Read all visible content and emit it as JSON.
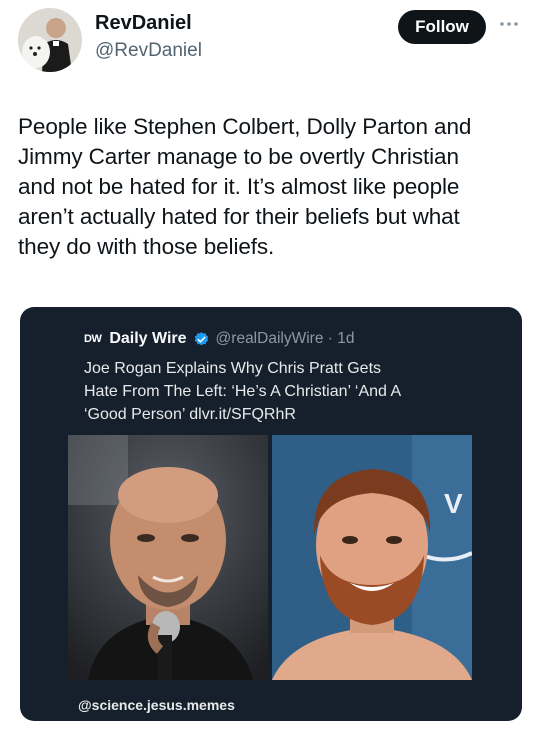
{
  "author": {
    "display_name": "RevDaniel",
    "handle": "@RevDaniel",
    "follow_label": "Follow",
    "more_icon": "more-horizontal-icon"
  },
  "tweet": {
    "lines": [
      "People like Stephen Colbert, Dolly Parton and",
      "Jimmy Carter manage to be overtly Christian",
      "and not be hated for it. It’s almost like people",
      "aren’t actually hated for their beliefs but what",
      "they do with those beliefs."
    ]
  },
  "quoted": {
    "logo_text": "DW",
    "source_name": "Daily Wire",
    "verified_icon": "verified-badge-icon",
    "meta": "@realDailyWire · 1d",
    "title_lines": [
      "Joe Rogan Explains Why Chris Pratt Gets",
      "Hate From The Left: ‘He’s A Christian’ ‘And A",
      "‘Good Person’ dlvr.it/SFQRhR"
    ],
    "photo_right_text": "V"
  },
  "watermark": "@science.jesus.memes",
  "colors": {
    "card_bg": "#16202c",
    "follow_bg": "#0f1419",
    "verified": "#1d9bf0",
    "secondary_text": "#536471"
  }
}
